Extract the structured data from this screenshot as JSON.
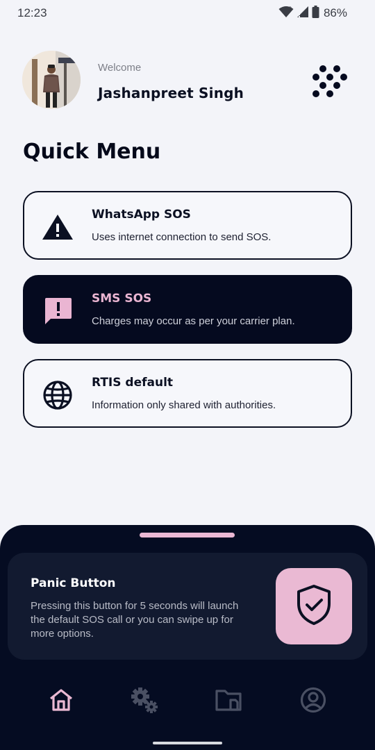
{
  "status_bar": {
    "time": "12:23",
    "battery": "86%",
    "icons": [
      "wifi-icon",
      "cellular-signal-icon",
      "battery-icon"
    ]
  },
  "header": {
    "welcome": "Welcome",
    "user_name": "Jashanpreet Singh",
    "avatar_icon": "avatar",
    "menu_icon": "dots-grid-icon"
  },
  "quick_menu": {
    "title": "Quick Menu",
    "items": [
      {
        "title": "WhatsApp SOS",
        "description": "Uses internet connection to send SOS.",
        "icon": "warning-triangle-icon",
        "active": false
      },
      {
        "title": "SMS SOS",
        "description": "Charges may occur as per your carrier plan.",
        "icon": "sms-alert-icon",
        "active": true
      },
      {
        "title": "RTIS default",
        "description": "Information only shared with authorities.",
        "icon": "globe-icon",
        "active": false
      }
    ]
  },
  "panic": {
    "title": "Panic Button",
    "description": "Pressing this button for 5 seconds will launch the default SOS call or you can swipe up for more options.",
    "icon": "shield-check-icon"
  },
  "bottom_nav": {
    "items": [
      {
        "name": "home",
        "icon": "home-icon",
        "active": true
      },
      {
        "name": "settings",
        "icon": "settings-gears-icon",
        "active": false
      },
      {
        "name": "files",
        "icon": "folder-icon",
        "active": false
      },
      {
        "name": "profile",
        "icon": "profile-icon",
        "active": false
      }
    ]
  },
  "colors": {
    "background": "#f3f4f9",
    "dark": "#050a1f",
    "accent_pink": "#eab9d3",
    "panic_card": "#121a30",
    "nav_inactive": "#4a5063"
  }
}
